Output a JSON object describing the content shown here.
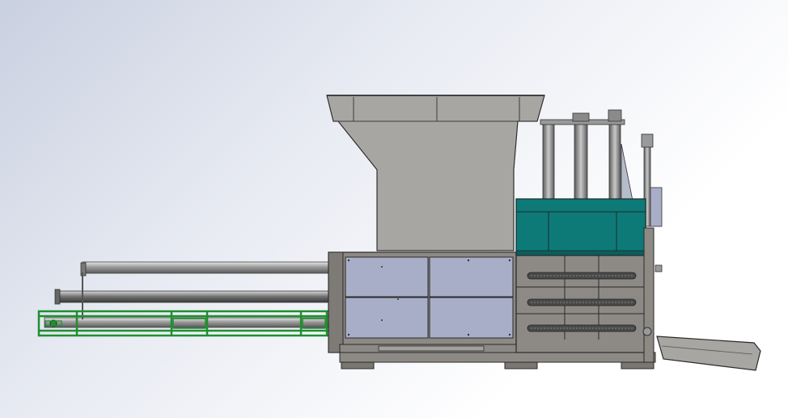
{
  "scene": {
    "view": "side elevation",
    "colors": {
      "background_top_left": "#c9d0e0",
      "background_bottom_right": "#ffffff",
      "hopper": "#a8a6a2",
      "frame_gray": "#8d8a86",
      "panel_blue": "#a9aec8",
      "teal_box": "#0e7a78",
      "green_rail": "#1f8f2f",
      "outline": "#2a2a2a"
    },
    "parts": [
      {
        "id": "hopper",
        "label": ""
      },
      {
        "id": "compression-chamber",
        "label": ""
      },
      {
        "id": "teal-cylinder-box",
        "label": ""
      },
      {
        "id": "ram-rods",
        "label": ""
      },
      {
        "id": "green-conveyor-frame",
        "label": ""
      },
      {
        "id": "ejection-chute",
        "label": ""
      }
    ]
  }
}
